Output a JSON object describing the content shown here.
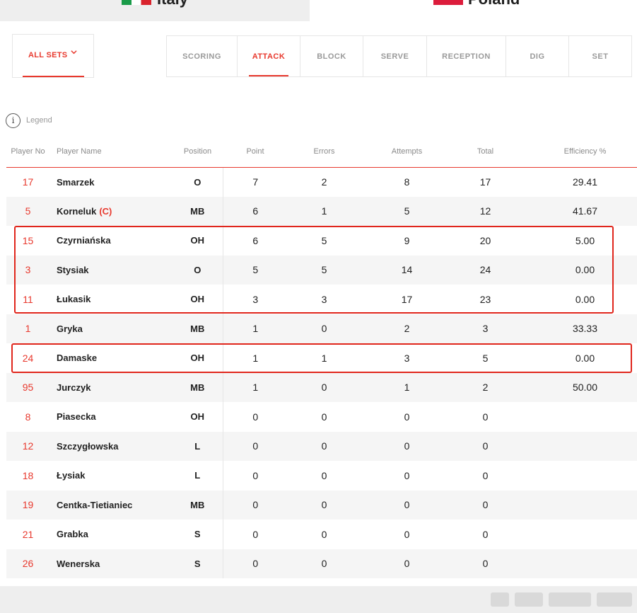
{
  "teams": [
    {
      "name": "Italy",
      "flag": "italy-flag"
    },
    {
      "name": "Poland",
      "flag": "poland-flag"
    }
  ],
  "set_filter": {
    "label": "ALL SETS",
    "icon": "chevron-down-icon"
  },
  "stat_tabs": [
    {
      "label": "SCORING",
      "active": false
    },
    {
      "label": "ATTACK",
      "active": true
    },
    {
      "label": "BLOCK",
      "active": false
    },
    {
      "label": "SERVE",
      "active": false
    },
    {
      "label": "RECEPTION",
      "active": false
    },
    {
      "label": "DIG",
      "active": false
    },
    {
      "label": "SET",
      "active": false
    }
  ],
  "legend": {
    "icon": "i",
    "label": "Legend"
  },
  "table": {
    "headers": {
      "player_no": "Player No",
      "player_name": "Player Name",
      "position": "Position",
      "point": "Point",
      "errors": "Errors",
      "attempts": "Attempts",
      "total": "Total",
      "efficiency": "Efficiency %"
    },
    "rows": [
      {
        "no": "17",
        "name": "Smarzek",
        "captain": "",
        "pos": "O",
        "point": "7",
        "errors": "2",
        "attempts": "8",
        "total": "17",
        "eff": "29.41"
      },
      {
        "no": "5",
        "name": "Korneluk",
        "captain": "(C)",
        "pos": "MB",
        "point": "6",
        "errors": "1",
        "attempts": "5",
        "total": "12",
        "eff": "41.67"
      },
      {
        "no": "15",
        "name": "Czyrniańska",
        "captain": "",
        "pos": "OH",
        "point": "6",
        "errors": "5",
        "attempts": "9",
        "total": "20",
        "eff": "5.00"
      },
      {
        "no": "3",
        "name": "Stysiak",
        "captain": "",
        "pos": "O",
        "point": "5",
        "errors": "5",
        "attempts": "14",
        "total": "24",
        "eff": "0.00"
      },
      {
        "no": "11",
        "name": "Łukasik",
        "captain": "",
        "pos": "OH",
        "point": "3",
        "errors": "3",
        "attempts": "17",
        "total": "23",
        "eff": "0.00"
      },
      {
        "no": "1",
        "name": "Gryka",
        "captain": "",
        "pos": "MB",
        "point": "1",
        "errors": "0",
        "attempts": "2",
        "total": "3",
        "eff": "33.33"
      },
      {
        "no": "24",
        "name": "Damaske",
        "captain": "",
        "pos": "OH",
        "point": "1",
        "errors": "1",
        "attempts": "3",
        "total": "5",
        "eff": "0.00"
      },
      {
        "no": "95",
        "name": "Jurczyk",
        "captain": "",
        "pos": "MB",
        "point": "1",
        "errors": "0",
        "attempts": "1",
        "total": "2",
        "eff": "50.00"
      },
      {
        "no": "8",
        "name": "Piasecka",
        "captain": "",
        "pos": "OH",
        "point": "0",
        "errors": "0",
        "attempts": "0",
        "total": "0",
        "eff": ""
      },
      {
        "no": "12",
        "name": "Szczygłowska",
        "captain": "",
        "pos": "L",
        "point": "0",
        "errors": "0",
        "attempts": "0",
        "total": "0",
        "eff": ""
      },
      {
        "no": "18",
        "name": "Łysiak",
        "captain": "",
        "pos": "L",
        "point": "0",
        "errors": "0",
        "attempts": "0",
        "total": "0",
        "eff": ""
      },
      {
        "no": "19",
        "name": "Centka-Tietianiec",
        "captain": "",
        "pos": "MB",
        "point": "0",
        "errors": "0",
        "attempts": "0",
        "total": "0",
        "eff": ""
      },
      {
        "no": "21",
        "name": "Grabka",
        "captain": "",
        "pos": "S",
        "point": "0",
        "errors": "0",
        "attempts": "0",
        "total": "0",
        "eff": ""
      },
      {
        "no": "26",
        "name": "Wenerska",
        "captain": "",
        "pos": "S",
        "point": "0",
        "errors": "0",
        "attempts": "0",
        "total": "0",
        "eff": ""
      }
    ]
  },
  "colors": {
    "accent": "#e8392e",
    "highlight": "#e0261c"
  }
}
